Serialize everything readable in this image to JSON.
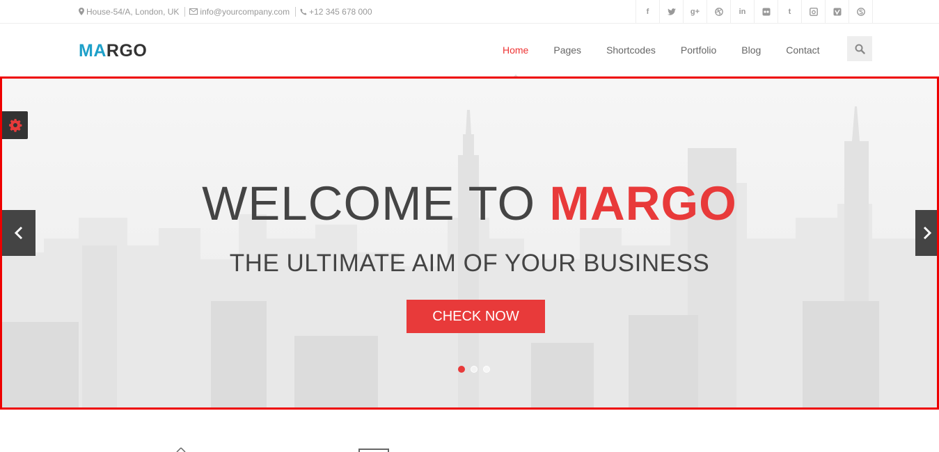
{
  "topbar": {
    "address": "House-54/A, London, UK",
    "email": "info@yourcompany.com",
    "phone": "+12 345 678 000",
    "socials": [
      "facebook-icon",
      "twitter-icon",
      "google-plus-icon",
      "dribbble-icon",
      "linkedin-icon",
      "flickr-icon",
      "tumblr-icon",
      "instagram-icon",
      "vimeo-icon",
      "skype-icon"
    ]
  },
  "logo": {
    "part1": "MA",
    "part2": "RGO"
  },
  "nav": {
    "items": [
      {
        "label": "Home"
      },
      {
        "label": "Pages"
      },
      {
        "label": "Shortcodes"
      },
      {
        "label": "Portfolio"
      },
      {
        "label": "Blog"
      },
      {
        "label": "Contact"
      }
    ],
    "active": "Home"
  },
  "hero": {
    "title_prefix": "WELCOME TO ",
    "title_highlight": "MARGO",
    "subtitle": "THE ULTIMATE AIM OF YOUR BUSINESS",
    "cta_label": "CHECK NOW",
    "slide_count": 3,
    "active_slide": 1
  },
  "colors": {
    "accent": "#e83a3a",
    "logo_blue": "#1ea0c9",
    "dark": "#444444",
    "highlight_border": "#ee0000"
  }
}
